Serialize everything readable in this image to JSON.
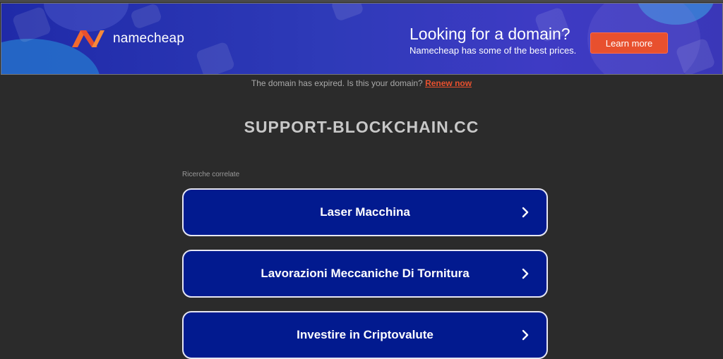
{
  "banner": {
    "logo_text": "namecheap",
    "promo_title": "Looking for a domain?",
    "promo_subtitle": "Namecheap has some of the best prices.",
    "learn_more_label": "Learn more",
    "accent_color": "#e8502e"
  },
  "notice": {
    "text": "The domain has expired. Is this your domain?",
    "renew_label": "Renew now"
  },
  "domain": "SUPPORT-BLOCKCHAIN.CC",
  "related": {
    "label": "Ricerche correlate",
    "items": [
      {
        "label": "Laser Macchina",
        "icon": "chevron-right-icon"
      },
      {
        "label": "Lavorazioni Meccaniche Di Tornitura",
        "icon": "chevron-right-icon"
      },
      {
        "label": "Investire in Criptovalute",
        "icon": "chevron-right-icon"
      }
    ]
  },
  "colors": {
    "background": "#2b2b2b",
    "card_background": "#021a8f"
  }
}
